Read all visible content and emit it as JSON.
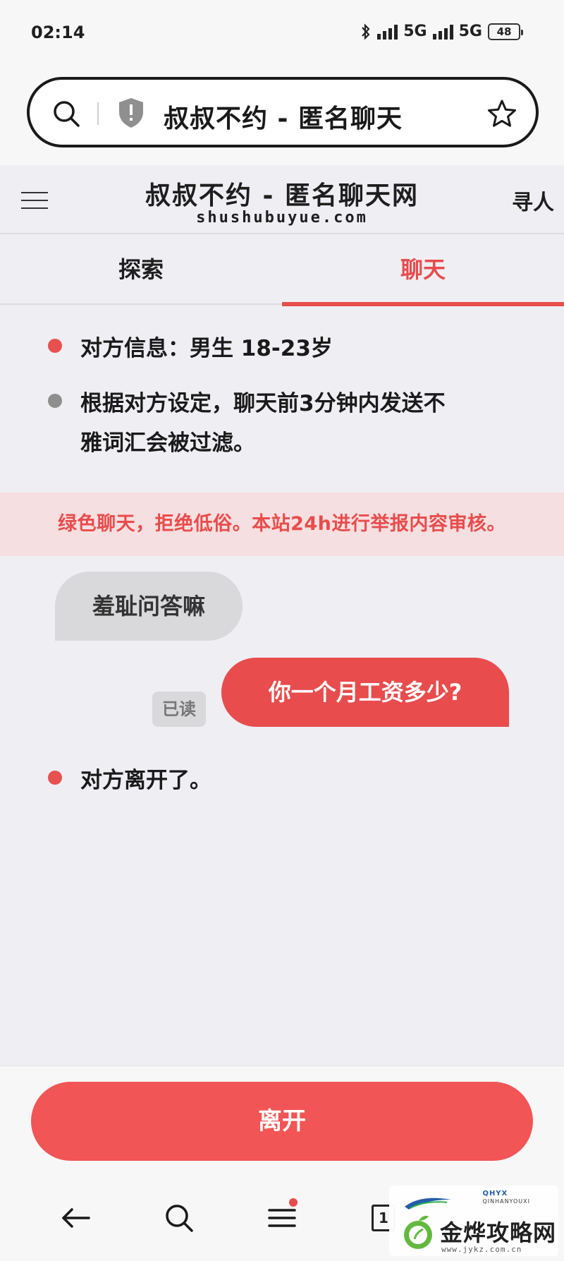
{
  "status_bar": {
    "time": "02:14",
    "network_1": "5G",
    "network_2": "5G",
    "battery": "48"
  },
  "browser": {
    "url_title": "叔叔不约 - 匿名聊天"
  },
  "site": {
    "title": "叔叔不约 - 匿名聊天网",
    "domain": "shushubuyue.com",
    "find_link": "寻人"
  },
  "tabs": [
    {
      "label": "探索",
      "active": false
    },
    {
      "label": "聊天",
      "active": true
    }
  ],
  "info": {
    "partner_info": "对方信息：男生 18-23岁",
    "filter_notice_line1": "根据对方设定，聊天前3分钟内发送不",
    "filter_notice_line2": "雅词汇会被过滤。"
  },
  "warning_banner": "绿色聊天，拒绝低俗。本站24h进行举报内容审核。",
  "messages": [
    {
      "direction": "in",
      "text": "羞耻问答嘛"
    },
    {
      "direction": "out",
      "text": "你一个月工资多少?",
      "status": "已读"
    }
  ],
  "system_message": "对方离开了。",
  "leave_button": "离开",
  "bottom_nav": {
    "tab_count": "1"
  },
  "watermark": {
    "small_logo": "QHYX",
    "small_text": "QINHANYOUXI",
    "brand": "金烨攻略网",
    "url": "www.jykz.com.cn"
  },
  "colors": {
    "accent": "#e84c4c",
    "banner_bg": "#f6dfe0",
    "bubble_in": "#d9d9db",
    "page_bg": "#efeef3"
  }
}
